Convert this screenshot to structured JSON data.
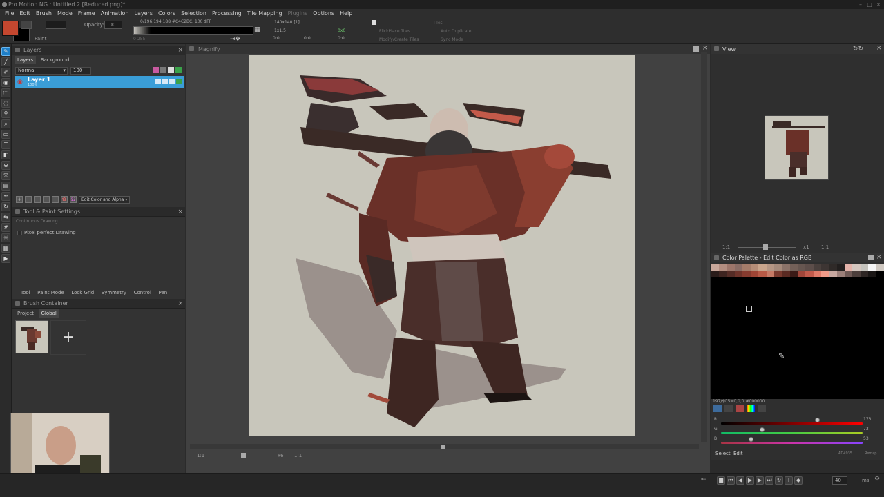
{
  "window": {
    "title": "Pro Motion NG : Untitled 2 [Reduced.png]*"
  },
  "menu": [
    {
      "label": "File"
    },
    {
      "label": "Edit"
    },
    {
      "label": "Brush"
    },
    {
      "label": "Mode"
    },
    {
      "label": "Frame"
    },
    {
      "label": "Animation"
    },
    {
      "label": "Layers"
    },
    {
      "label": "Colors"
    },
    {
      "label": "Selection"
    },
    {
      "label": "Processing"
    },
    {
      "label": "Tile Mapping"
    },
    {
      "label": "Plugins"
    },
    {
      "label": "Options"
    },
    {
      "label": "Help"
    }
  ],
  "toolbar": {
    "paint_label": "Paint",
    "brush_size": "1",
    "opacity_label": "Opacity:",
    "opacity_value": "100",
    "color_info": "0/196,194,188 #C4C2BC, 100 $FF",
    "alpha_range": "0-255",
    "canvas_size": "140x140 [1]",
    "zoom": "1x1.5",
    "pos_a": "0:0",
    "pos_b": "0:0",
    "pos_c": "0:0",
    "pos_d": "0x0",
    "flickplace": "FlickPlace Tiles",
    "modify_create": "Modify/Create Tiles",
    "tiles_label": "Tiles: ---",
    "auto_duplicate": "Auto Duplicate",
    "sync_mode": "Sync Mode",
    "fg_color": "#c4472f",
    "bg_color": "#000000"
  },
  "layers_panel": {
    "title": "Layers",
    "tabs": [
      "Layers",
      "Background"
    ],
    "blend_mode": "Normal",
    "opacity": "100",
    "layer_name": "Layer 1",
    "layer_opacity": "100%",
    "edit_mode": "Edit Color and Alpha"
  },
  "tool_settings": {
    "title": "Tool & Paint Settings",
    "mode_label": "Continuous Drawing",
    "pixel_perfect": "Pixel perfect Drawing",
    "tabs": [
      "Tool",
      "Paint Mode",
      "Lock Grid",
      "Symmetry",
      "Control",
      "Pen"
    ]
  },
  "brush_container": {
    "title": "Brush Container",
    "tabs": [
      "Project",
      "Global"
    ],
    "add_label": "+"
  },
  "magnify": {
    "title": "Magnify",
    "zoom_left": "1:1",
    "zoom_mult": "x6",
    "zoom_right": "1:1"
  },
  "view_panel": {
    "title": "View",
    "zoom_left": "1:1",
    "zoom_mult": "x1",
    "zoom_right": "1:1"
  },
  "palette_panel": {
    "title": "Color Palette - Edit Color as RGB",
    "color_info": "197/$C5=0,0,0 #000000",
    "r_value": "173",
    "g_value": "73",
    "b_value": "53",
    "r": 0.68,
    "g": 0.29,
    "b": 0.21,
    "select_label": "Select",
    "edit_label": "Edit",
    "hex_value": "AD4935",
    "remap_label": "Remap",
    "row1": [
      "#c9a79a",
      "#b38d80",
      "#9d766b",
      "#8a6d66",
      "#a47c6a",
      "#b58d77",
      "#c9a58c",
      "#b59684",
      "#a58a7b",
      "#8b7369",
      "#736058",
      "#665650",
      "#5d4e4a",
      "#4a403d",
      "#3d3533",
      "#2f2a28",
      "#221f1e",
      "#e4b3aa",
      "#d4c6bf",
      "#c4c2bc",
      "#f5f5f5",
      "#cfc8c1"
    ],
    "row2": [
      "#2a1c1a",
      "#3e2420",
      "#552c26",
      "#6e332a",
      "#873b2f",
      "#a04535",
      "#b85a46",
      "#c77b66",
      "#7a3a2e",
      "#5a2a22",
      "#3b1a16",
      "#a1463a",
      "#c25a4b",
      "#e07a68",
      "#f09a88",
      "#c8a8a0",
      "#9c807a",
      "#705a56",
      "#4c3e3b",
      "#2e2624",
      "#1a1615",
      "#000000"
    ]
  },
  "bottom": {
    "fps": "40",
    "ms_label": "ms"
  }
}
